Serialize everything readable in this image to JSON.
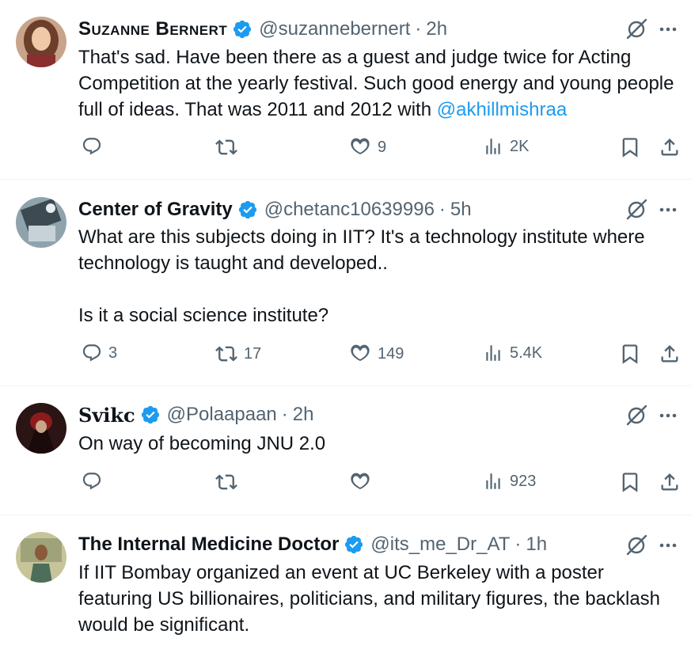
{
  "tweets": [
    {
      "name": "Suzanne Bernert",
      "handle": "@suzannebernert",
      "time": "2h",
      "text": "That's sad. Have been there as a guest and judge twice for Acting Competition at the yearly festival. Such good energy and young people full of ideas. That was 2011 and 2012 with ",
      "mention": "@akhillmishraa",
      "replies": "",
      "reposts": "",
      "likes": "9",
      "views": "2K"
    },
    {
      "name": "Center of Gravity",
      "handle": "@chetanc10639996",
      "time": "5h",
      "text": "What are this subjects doing in IIT? It's a technology institute where technology is taught and developed..\n\nIs it a social science institute?",
      "mention": "",
      "replies": "3",
      "reposts": "17",
      "likes": "149",
      "views": "5.4K"
    },
    {
      "name": "Svikc",
      "handle": "@Polaapaan",
      "time": "2h",
      "text": "On way of becoming JNU 2.0",
      "mention": "",
      "replies": "",
      "reposts": "",
      "likes": "",
      "views": "923"
    },
    {
      "name": "The Internal Medicine Doctor",
      "handle": "@its_me_Dr_AT",
      "time": "1h",
      "text": "If IIT Bombay organized an event at UC Berkeley with a poster featuring US billionaires, politicians, and military figures, the backlash would be significant.",
      "mention": "",
      "replies": "",
      "reposts": "",
      "likes": "",
      "views": ""
    }
  ],
  "ui": {
    "separator": "·",
    "accent_color": "#1d9bf0",
    "muted_color": "#536471",
    "icons": [
      "verified-badge-icon",
      "grok-icon",
      "more-icon",
      "reply-icon",
      "repost-icon",
      "like-icon",
      "views-icon",
      "bookmark-icon",
      "share-icon"
    ]
  }
}
